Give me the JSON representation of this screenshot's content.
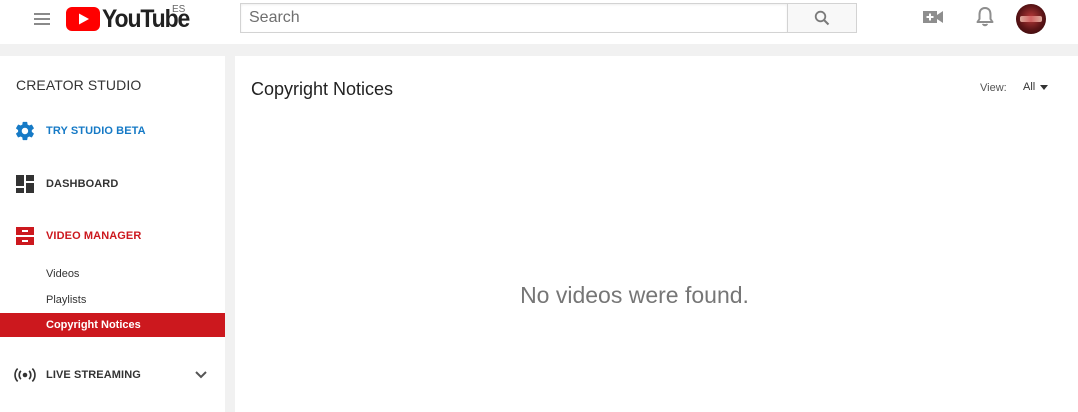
{
  "masthead": {
    "logo_text": "YouTube",
    "country_code": "ES",
    "search": {
      "placeholder": "Search",
      "value": ""
    },
    "icons": [
      "menu-icon",
      "search-icon",
      "upload-video-icon",
      "notifications-bell-icon",
      "avatar"
    ]
  },
  "sidebar": {
    "title": "CREATOR STUDIO",
    "items": [
      {
        "label": "TRY STUDIO BETA",
        "icon": "gear-icon",
        "color": "#167ac6"
      },
      {
        "label": "DASHBOARD",
        "icon": "dashboard-icon",
        "color": "#333333"
      },
      {
        "label": "VIDEO MANAGER",
        "icon": "video-manager-icon",
        "color": "#cc181e"
      },
      {
        "label": "LIVE STREAMING",
        "icon": "live-broadcast-icon",
        "color": "#333333"
      }
    ],
    "subitems": [
      {
        "label": "Videos",
        "active": false
      },
      {
        "label": "Playlists",
        "active": false
      },
      {
        "label": "Copyright Notices",
        "active": true
      }
    ]
  },
  "main": {
    "title": "Copyright Notices",
    "view_label": "View:",
    "view_value": "All",
    "empty_message": "No videos were found."
  },
  "colors": {
    "accent_red": "#cc181e",
    "accent_blue": "#167ac6",
    "background": "#f1f1f1"
  }
}
